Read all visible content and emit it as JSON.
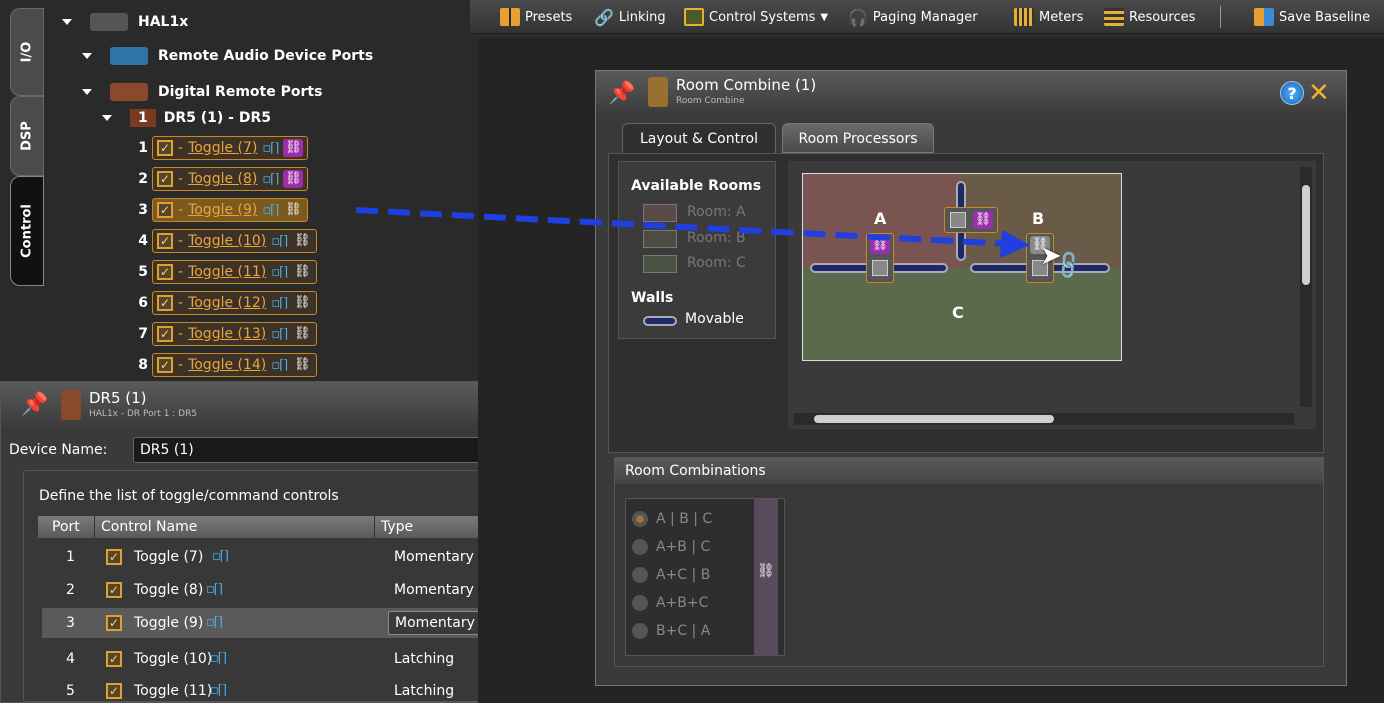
{
  "toolbar": {
    "presets": "Presets",
    "linking": "Linking",
    "control_systems": "Control Systems",
    "paging_manager": "Paging Manager",
    "meters": "Meters",
    "resources": "Resources",
    "save_baseline": "Save Baseline"
  },
  "vtabs": {
    "io": "I/O",
    "dsp": "DSP",
    "control": "Control"
  },
  "tree": {
    "device": "HAL1x",
    "remote_audio": "Remote Audio Device Ports",
    "digital_remote": "Digital Remote Ports",
    "dr5_num": "1",
    "dr5_label": "DR5 (1) - DR5",
    "controls": [
      {
        "num": "1",
        "label": "Toggle (7)"
      },
      {
        "num": "2",
        "label": "Toggle (8)"
      },
      {
        "num": "3",
        "label": "Toggle (9)"
      },
      {
        "num": "4",
        "label": "Toggle (10)"
      },
      {
        "num": "5",
        "label": "Toggle (11)"
      },
      {
        "num": "6",
        "label": "Toggle (12)"
      },
      {
        "num": "7",
        "label": "Toggle (13)"
      },
      {
        "num": "8",
        "label": "Toggle (14)"
      }
    ]
  },
  "dr5": {
    "title": "DR5 (1)",
    "subtitle": "HAL1x - DR Port 1 : DR5",
    "device_name_label": "Device Name:",
    "device_name_value": "DR5 (1)",
    "define_label": "Define the list of toggle/command controls",
    "col_port": "Port",
    "col_name": "Control Name",
    "col_type": "Type",
    "rows": [
      {
        "port": "1",
        "name": "Toggle (7)",
        "type": "Momentary"
      },
      {
        "port": "2",
        "name": "Toggle (8)",
        "type": "Momentary"
      },
      {
        "port": "3",
        "name": "Toggle (9)",
        "type": "Momentary"
      },
      {
        "port": "4",
        "name": "Toggle (10)",
        "type": "Latching"
      },
      {
        "port": "5",
        "name": "Toggle (11)",
        "type": "Latching"
      }
    ]
  },
  "room_combine": {
    "title": "Room Combine (1)",
    "subtitle": "Room Combine",
    "tab_layout": "Layout & Control",
    "tab_processors": "Room Processors",
    "available_rooms": "Available Rooms",
    "rooms": [
      "Room: A",
      "Room: B",
      "Room: C"
    ],
    "walls": "Walls",
    "movable": "Movable",
    "room_a": "A",
    "room_b": "B",
    "room_c": "C",
    "room_combinations": "Room Combinations",
    "combinations": [
      "A | B | C",
      "A+B | C",
      "A+C | B",
      "A+B+C",
      "B+C | A"
    ]
  },
  "colors": {
    "accent_orange": "#c8891f",
    "link_purple": "#9b2fa8",
    "arrow_blue": "#1f3fe0",
    "room_a": "#7a5450",
    "room_b": "#6a5a48",
    "room_c": "#5b6a4b",
    "wall_blue": "#1e2a66"
  },
  "icons": {
    "pin": "pin-icon",
    "help": "help-icon",
    "close": "close-icon",
    "link": "chain-link-icon",
    "toggle": "toggle-icon",
    "checkbox": "checkbox-icon"
  }
}
